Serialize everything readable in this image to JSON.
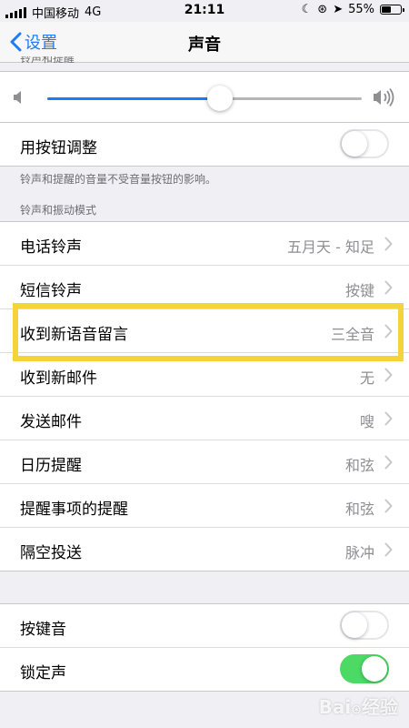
{
  "status_bar": {
    "carrier": "中国移动",
    "network": "4G",
    "time": "21:11",
    "battery": "55%",
    "battery_level": 0.55
  },
  "nav": {
    "back_label": "设置",
    "title": "声音"
  },
  "cut_section_header": "铃声和提醒",
  "volume": {
    "level": 0.55,
    "accent": "#1c7bf5"
  },
  "button_adjust": {
    "label": "用按钮调整",
    "on": false,
    "footnote": "铃声和提醒的音量不受音量按钮的影响。"
  },
  "sounds_section": {
    "header": "铃声和振动模式",
    "items": [
      {
        "label": "电话铃声",
        "value": "五月天 - 知足"
      },
      {
        "label": "短信铃声",
        "value": "按键"
      },
      {
        "label": "收到新语音留言",
        "value": "三全音"
      },
      {
        "label": "收到新邮件",
        "value": "无"
      },
      {
        "label": "发送邮件",
        "value": "嗖"
      },
      {
        "label": "日历提醒",
        "value": "和弦"
      },
      {
        "label": "提醒事项的提醒",
        "value": "和弦"
      },
      {
        "label": "隔空投送",
        "value": "脉冲"
      }
    ]
  },
  "bottom_toggles": [
    {
      "label": "按键音",
      "on": false
    },
    {
      "label": "锁定声",
      "on": true
    }
  ],
  "highlight_color": "#f4d33b",
  "toggle_on_color": "#4cd964",
  "watermark": "Bai 经验"
}
